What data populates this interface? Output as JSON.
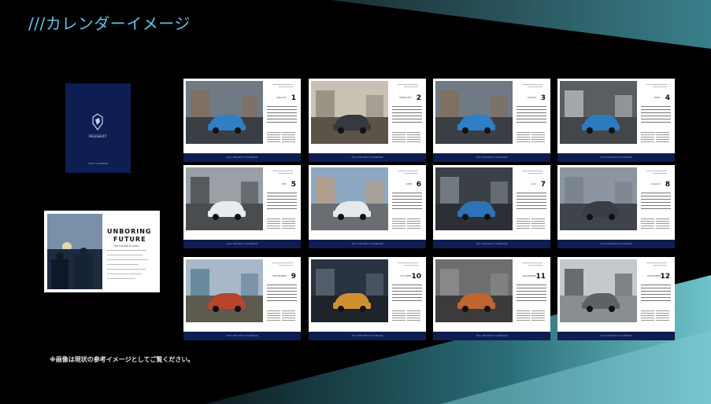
{
  "title": "///カレンダーイメージ",
  "cover": {
    "brand": "PEUGEOT",
    "footer": "2021 CALENDAR"
  },
  "spread": {
    "heading1": "UNBORING",
    "heading2": "FUTURE",
    "sub": "THE FUTURE IS OURS"
  },
  "months": [
    {
      "num": "1",
      "name": "JANUARY",
      "scene": "city-car"
    },
    {
      "num": "2",
      "name": "FEBRUARY",
      "scene": "desert-road"
    },
    {
      "num": "3",
      "name": "MARCH",
      "scene": "city-car"
    },
    {
      "num": "4",
      "name": "APRIL",
      "scene": "aerial"
    },
    {
      "num": "5",
      "name": "MAY",
      "scene": "parking"
    },
    {
      "num": "6",
      "name": "JUNE",
      "scene": "building"
    },
    {
      "num": "7",
      "name": "JULY",
      "scene": "garage"
    },
    {
      "num": "8",
      "name": "AUGUST",
      "scene": "street"
    },
    {
      "num": "9",
      "name": "SEPTEMBER",
      "scene": "coast"
    },
    {
      "num": "10",
      "name": "OCTOBER",
      "scene": "night-city"
    },
    {
      "num": "11",
      "name": "NOVEMBER",
      "scene": "park-wall"
    },
    {
      "num": "12",
      "name": "DECEMBER",
      "scene": "modern-house"
    }
  ],
  "band_text": "2021 PEUGEOT CALENDAR",
  "note": "※画像は現状の参考イメージとしてご覧ください。",
  "colors": {
    "title": "#5cc6e6",
    "navy": "#0e1d52",
    "teal": "#4fa9b8"
  }
}
